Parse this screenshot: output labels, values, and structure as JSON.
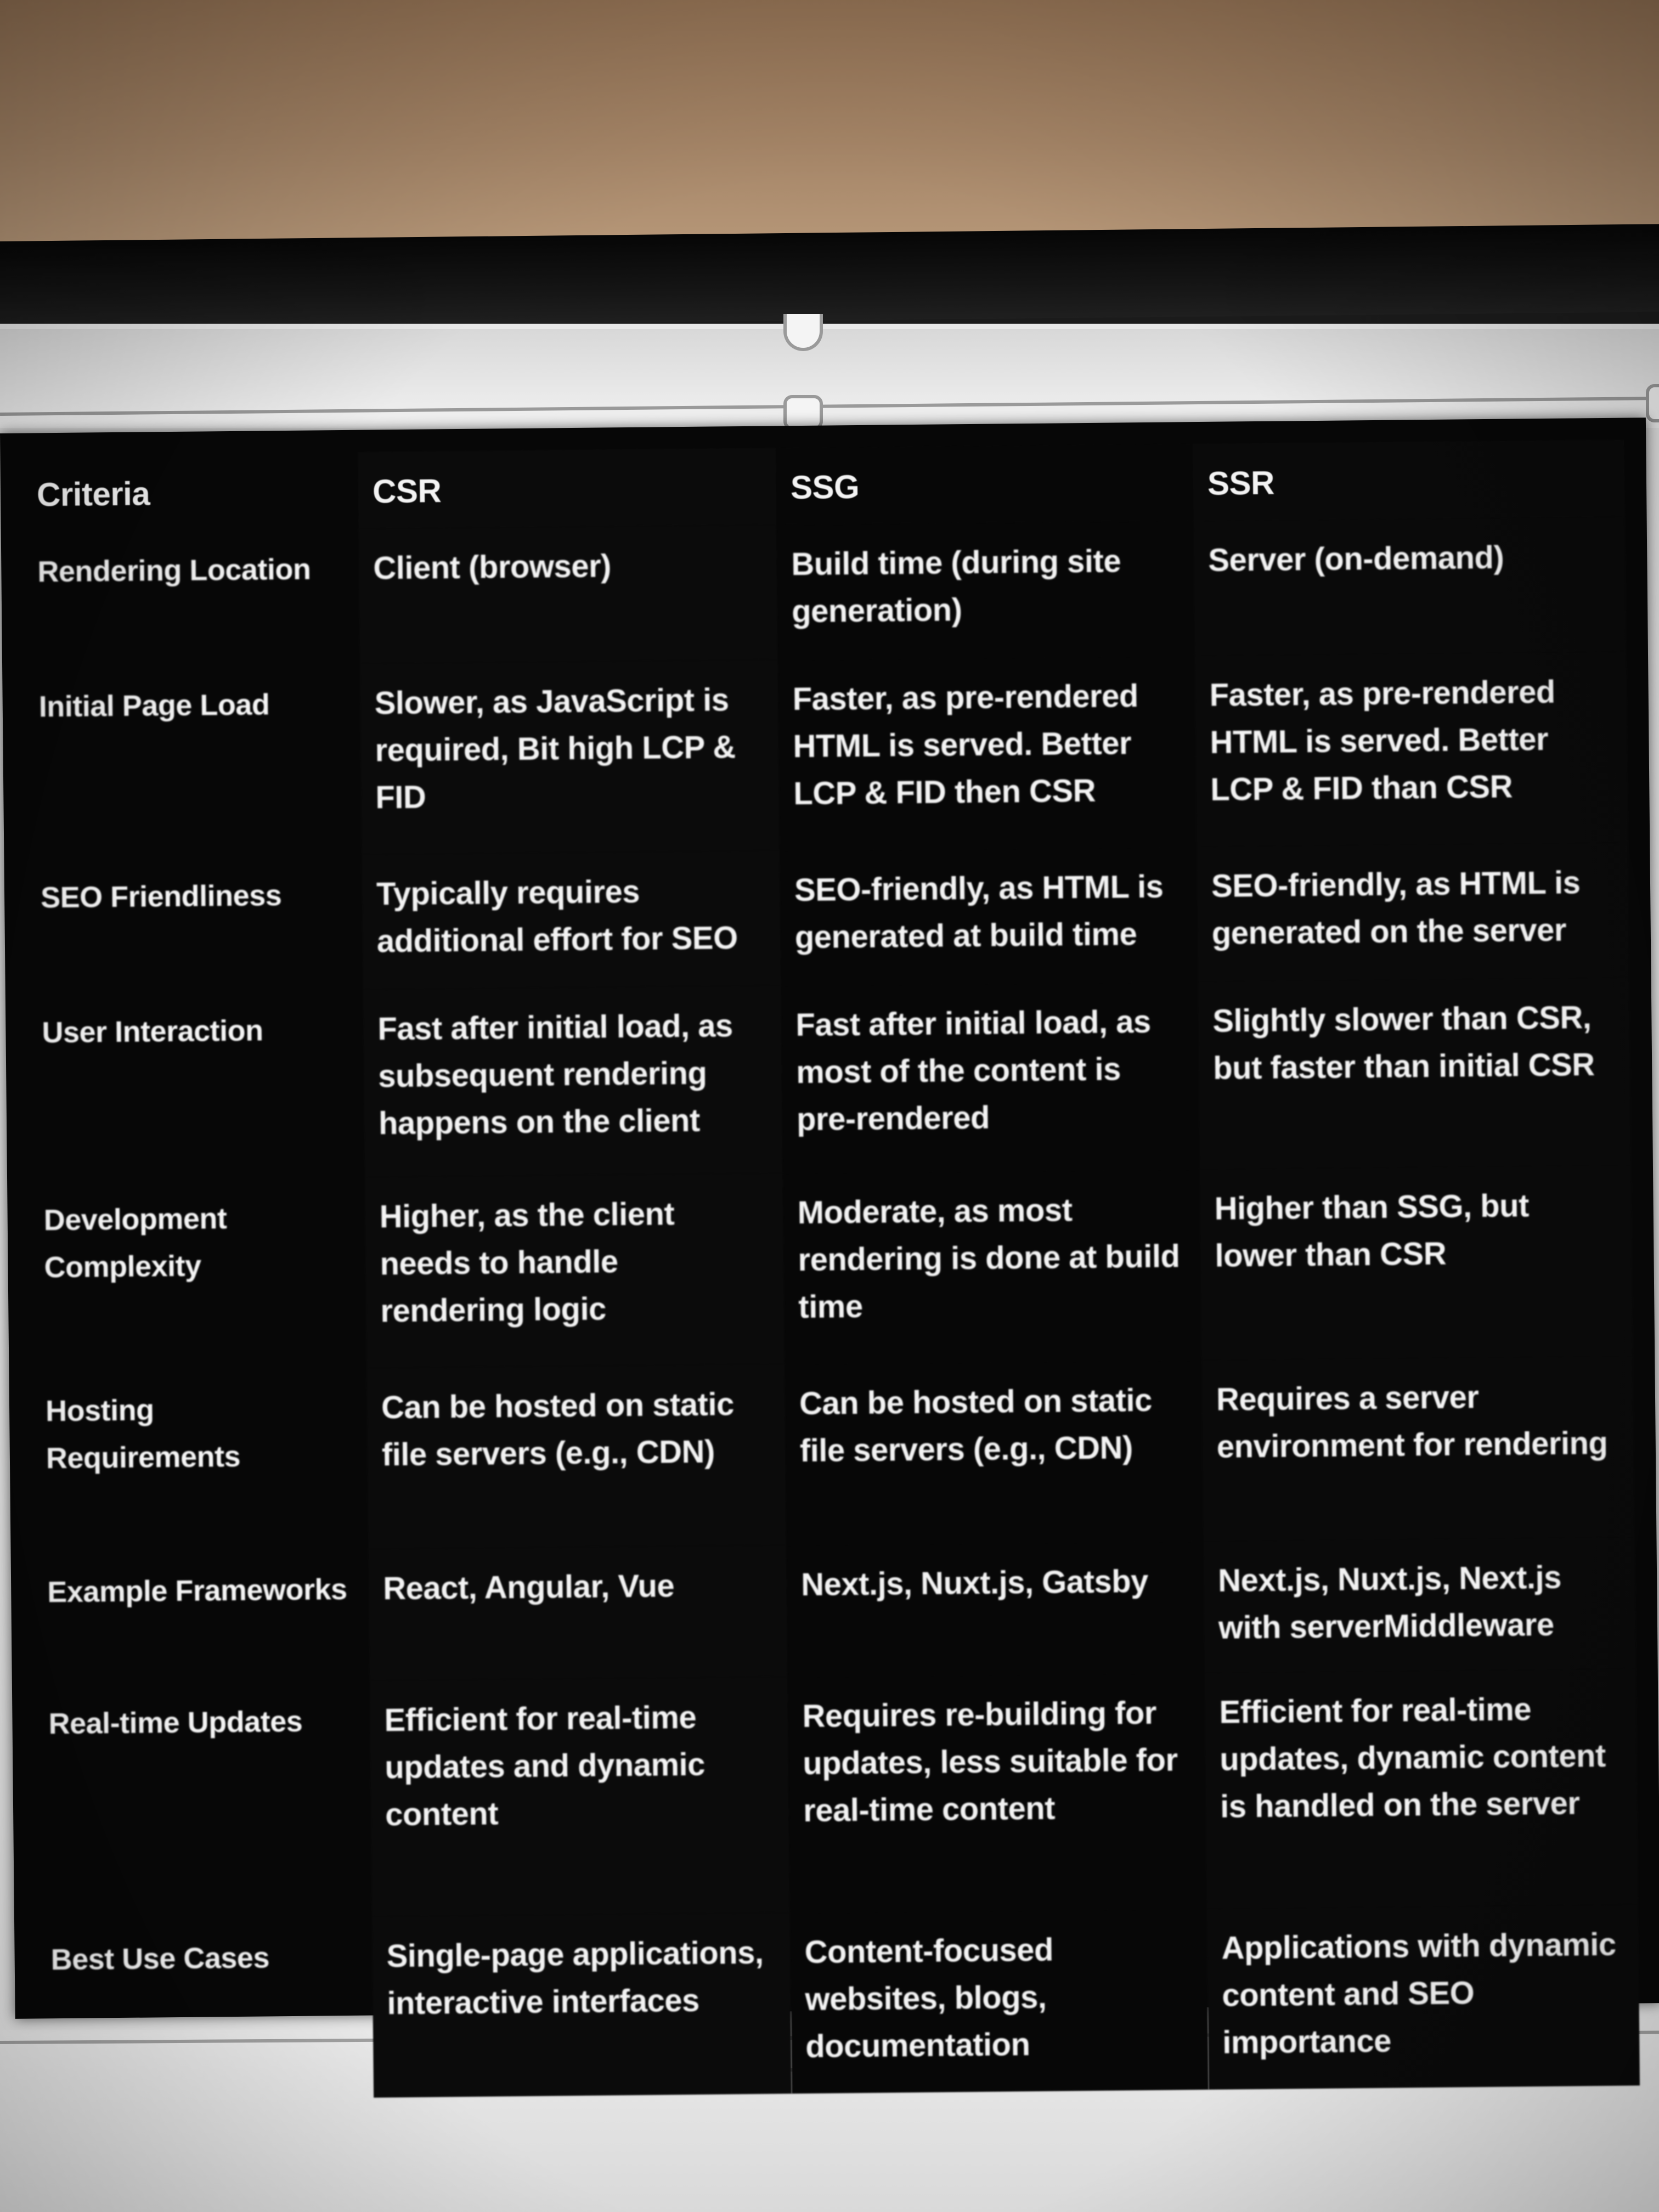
{
  "table": {
    "headers": [
      "Criteria",
      "CSR",
      "SSG",
      "SSR"
    ],
    "rows": [
      {
        "criteria": "Rendering Location",
        "csr": "Client (browser)",
        "ssg": "Build time (during site generation)",
        "ssr": "Server (on-demand)"
      },
      {
        "criteria": "Initial Page Load",
        "csr": "Slower, as JavaScript is required, Bit high LCP & FID",
        "ssg": "Faster, as pre-rendered HTML is served. Better LCP & FID then CSR",
        "ssr": "Faster, as pre-rendered HTML is served. Better LCP & FID than CSR"
      },
      {
        "criteria": "SEO Friendliness",
        "csr": "Typically requires additional effort for SEO",
        "ssg": "SEO-friendly, as HTML is generated at build time",
        "ssr": "SEO-friendly, as HTML is generated on the server"
      },
      {
        "criteria": "User Interaction",
        "csr": "Fast after initial load, as subsequent rendering happens on the client",
        "ssg": "Fast after initial load, as most of the content is pre-rendered",
        "ssr": "Slightly slower than CSR, but faster than initial CSR"
      },
      {
        "criteria": "Development Complexity",
        "csr": "Higher, as the client needs to handle rendering logic",
        "ssg": "Moderate, as most rendering is done at build time",
        "ssr": "Higher than SSG, but lower than CSR"
      },
      {
        "criteria": "Hosting Requirements",
        "csr": "Can be hosted on static file servers (e.g., CDN)",
        "ssg": "Can be hosted on static file servers (e.g., CDN)",
        "ssr": "Requires a server environment for rendering"
      },
      {
        "criteria": "Example Frameworks",
        "csr": "React, Angular, Vue",
        "ssg": "Next.js, Nuxt.js, Gatsby",
        "ssr": "Next.js, Nuxt.js, Next.js with serverMiddleware"
      },
      {
        "criteria": "Real-time Updates",
        "csr": "Efficient for real-time updates and dynamic content",
        "ssg": "Requires re-building for updates, less suitable for real-time content",
        "ssr": "Efficient for real-time updates, dynamic content is handled on the server"
      },
      {
        "criteria": "Best Use Cases",
        "csr": "Single-page applications, interactive interfaces",
        "ssg": "Content-focused websites, blogs, documentation",
        "ssr": "Applications with dynamic content and SEO importance"
      }
    ]
  }
}
